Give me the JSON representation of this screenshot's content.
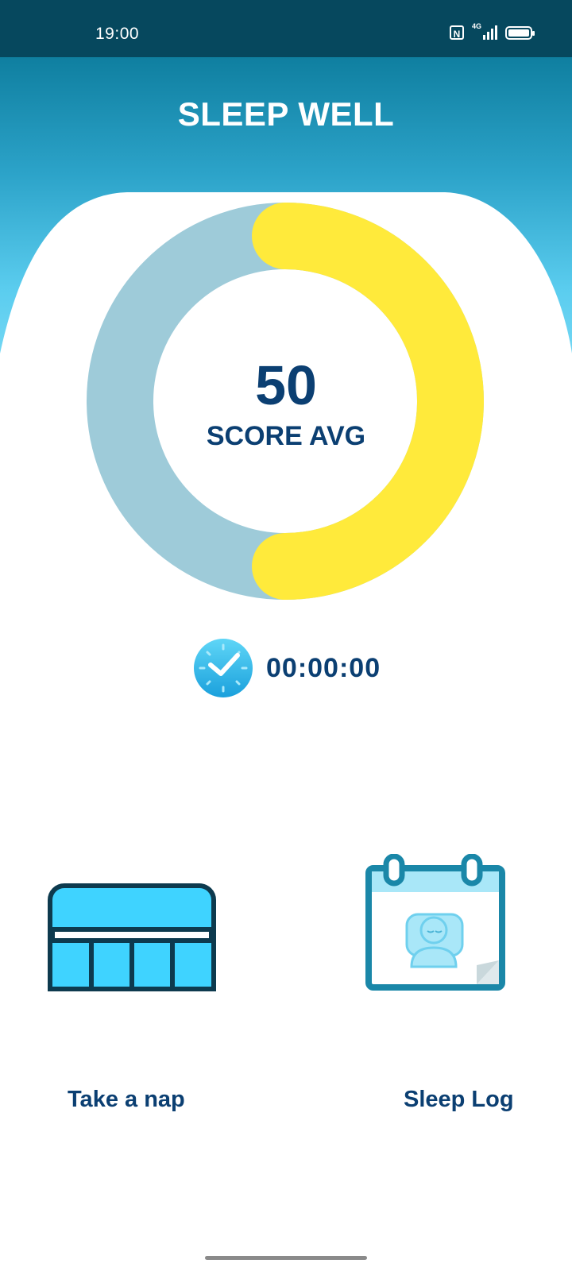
{
  "status": {
    "time": "19:00",
    "network": "4G"
  },
  "app": {
    "title": "SLEEP WELL"
  },
  "score": {
    "value": "50",
    "label": "SCORE AVG",
    "fraction": 0.5
  },
  "timer": {
    "value": "00:00:00"
  },
  "actions": {
    "nap_label": "Take a nap",
    "log_label": "Sleep Log"
  },
  "colors": {
    "header_top": "#0f7fa0",
    "header_bottom": "#7fdcf6",
    "ring_track": "#9ecbd9",
    "ring_fill": "#ffea3b",
    "text_primary": "#0b3f72",
    "icon_fill": "#3fd3ff",
    "icon_stroke": "#0d3a4e"
  }
}
